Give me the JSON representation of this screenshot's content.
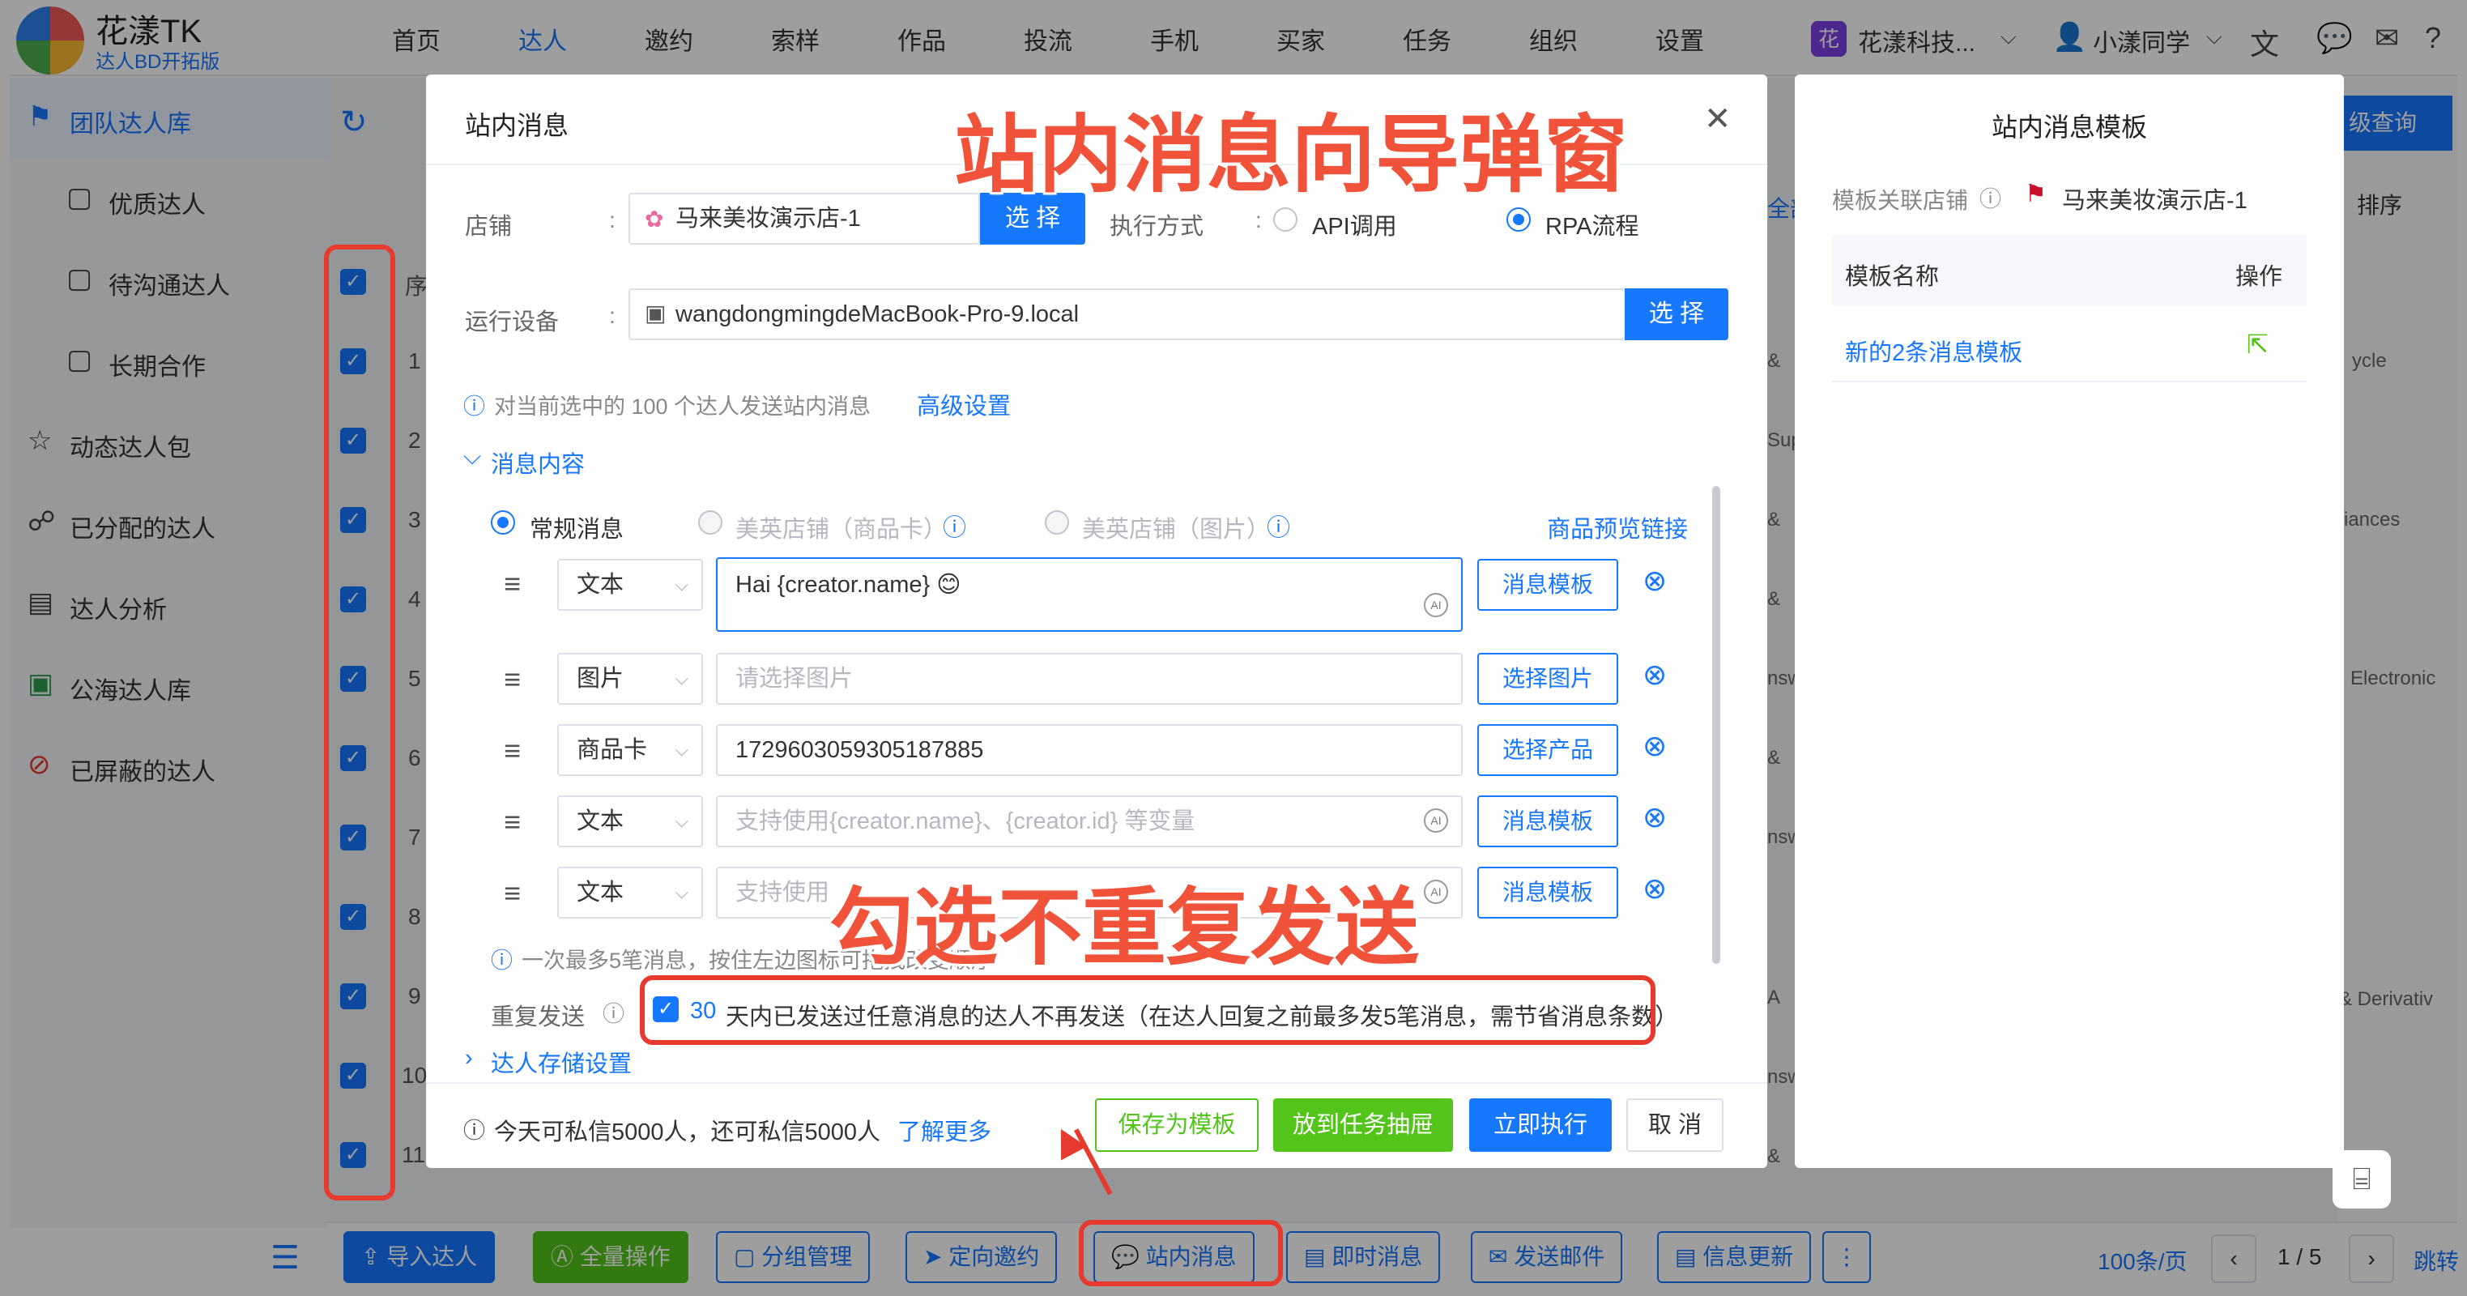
{
  "app": {
    "title": "花漾TK",
    "subtitle": "达人BD开拓版"
  },
  "nav": {
    "items": [
      "首页",
      "达人",
      "邀约",
      "索样",
      "作品",
      "投流",
      "手机",
      "买家",
      "任务",
      "组织",
      "设置"
    ],
    "active": "达人",
    "company_badge": "花",
    "company": "花漾科技...",
    "user": "小漾同学"
  },
  "sidebar": {
    "items": [
      {
        "label": "团队达人库",
        "icon": "team-icon"
      },
      {
        "label": "优质达人",
        "icon": "folder-icon"
      },
      {
        "label": "待沟通达人",
        "icon": "folder-icon"
      },
      {
        "label": "长期合作",
        "icon": "folder-icon"
      },
      {
        "label": "动态达人包",
        "icon": "star-icon"
      },
      {
        "label": "已分配的达人",
        "icon": "assign-icon"
      },
      {
        "label": "达人分析",
        "icon": "chart-icon"
      },
      {
        "label": "公海达人库",
        "icon": "sea-icon"
      },
      {
        "label": "已屏蔽的达人",
        "icon": "block-icon"
      }
    ]
  },
  "background": {
    "table_header_fragment": "序",
    "row_indices": [
      "1",
      "2",
      "3",
      "4",
      "5",
      "6",
      "7",
      "8",
      "9",
      "10",
      "11"
    ],
    "tab_fragment": "全部",
    "adv_query": "级查询",
    "sort": "排序",
    "right_fragments": [
      "ycle",
      "iances",
      "Electronic",
      "& Derivativ"
    ],
    "mid_fragments": [
      "&",
      "Sup",
      "&",
      "&",
      "nsw",
      "&",
      "nsw",
      "A",
      "nsw",
      "&"
    ]
  },
  "bottom_bar": {
    "buttons": [
      "导入达人",
      "全量操作",
      "分组管理",
      "定向邀约",
      "站内消息",
      "即时消息",
      "发送邮件",
      "信息更新"
    ],
    "more": "⋮",
    "page_size": "100条/页",
    "page": "1 / 5",
    "jump": "跳转"
  },
  "modal": {
    "title": "站内消息",
    "shop_label": "店铺",
    "shop_value": "马来美妆演示店-1",
    "select_btn": "选 择",
    "exec_label": "执行方式",
    "exec_options": [
      "API调用",
      "RPA流程"
    ],
    "exec_selected": "RPA流程",
    "device_label": "运行设备",
    "device_value": "wangdongmingdeMacBook-Pro-9.local",
    "info_text": "对当前选中的 100 个达人发送站内消息",
    "advanced_link": "高级设置",
    "section_message": "消息内容",
    "msg_types": [
      "常规消息",
      "美英店铺（商品卡）",
      "美英店铺（图片）"
    ],
    "msg_type_selected": "常规消息",
    "preview_link": "商品预览链接",
    "rows": [
      {
        "type": "文本",
        "value": "Hai {creator.name} 😊",
        "placeholder": "",
        "action": "消息模板"
      },
      {
        "type": "图片",
        "value": "",
        "placeholder": "请选择图片",
        "action": "选择图片"
      },
      {
        "type": "商品卡",
        "value": "1729603059305187885",
        "placeholder": "",
        "action": "选择产品"
      },
      {
        "type": "文本",
        "value": "",
        "placeholder": "支持使用{creator.name}、{creator.id} 等变量",
        "action": "消息模板"
      },
      {
        "type": "文本",
        "value": "",
        "placeholder": "支持使用",
        "action": "消息模板"
      }
    ],
    "limit_hint": "一次最多5笔消息，按住左边图标可拖拽改变顺序",
    "repeat_label": "重复发送",
    "repeat_days": "30",
    "repeat_text": "天内已发送过任意消息的达人不再发送（在达人回复之前最多发5笔消息，需节省消息条数）",
    "storage_section": "达人存储设置",
    "quota_text": "今天可私信5000人，还可私信5000人",
    "learn_more": "了解更多",
    "save_template": "保存为模板",
    "to_drawer": "放到任务抽屉",
    "execute": "立即执行",
    "cancel": "取 消"
  },
  "template_panel": {
    "title": "站内消息模板",
    "shop_label": "模板关联店铺",
    "shop_value": "马来美妆演示店-1",
    "col_name": "模板名称",
    "col_op": "操作",
    "row_name": "新的2条消息模板"
  },
  "annotations": {
    "wizard": "站内消息向导弹窗",
    "no_repeat": "勾选不重复发送"
  },
  "colors": {
    "primary": "#1677ff",
    "green": "#52c41a",
    "annotation": "#e63a2e"
  }
}
